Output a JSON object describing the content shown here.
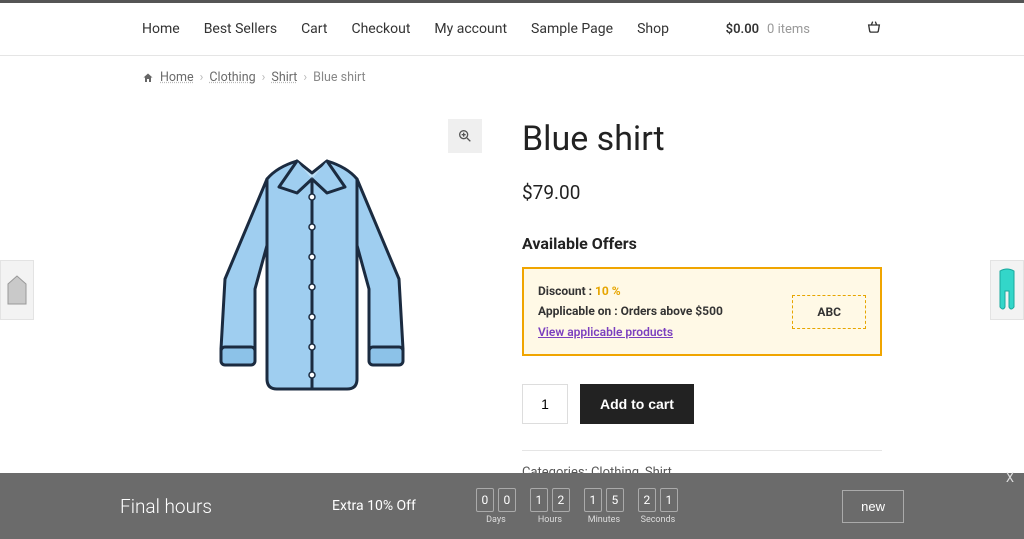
{
  "nav": {
    "items": [
      "Home",
      "Best Sellers",
      "Cart",
      "Checkout",
      "My account",
      "Sample Page",
      "Shop"
    ]
  },
  "cart": {
    "amount": "$0.00",
    "items": "0 items"
  },
  "breadcrumbs": {
    "home": "Home",
    "clothing": "Clothing",
    "shirt": "Shirt",
    "current": "Blue shirt"
  },
  "product": {
    "title": "Blue shirt",
    "price": "$79.00",
    "offers_heading": "Available Offers",
    "offer": {
      "discount_label": "Discount :",
      "discount_value": "10 %",
      "applicable_label": "Applicable on :",
      "applicable_value": "Orders above $500",
      "view_link": "View applicable products",
      "code": "ABC"
    },
    "qty": "1",
    "add_to_cart": "Add to cart",
    "meta": {
      "categories_label": "Categories:",
      "cat1": "Clothing",
      "cat2": "Shirt",
      "sep": ", "
    }
  },
  "countdown": {
    "title": "Final hours",
    "subtitle": "Extra 10% Off",
    "button": "new",
    "close": "X",
    "days": {
      "d1": "0",
      "d2": "0",
      "label": "Days"
    },
    "hours": {
      "d1": "1",
      "d2": "2",
      "label": "Hours"
    },
    "minutes": {
      "d1": "1",
      "d2": "5",
      "label": "Minutes"
    },
    "seconds": {
      "d1": "2",
      "d2": "1",
      "label": "Seconds"
    }
  }
}
